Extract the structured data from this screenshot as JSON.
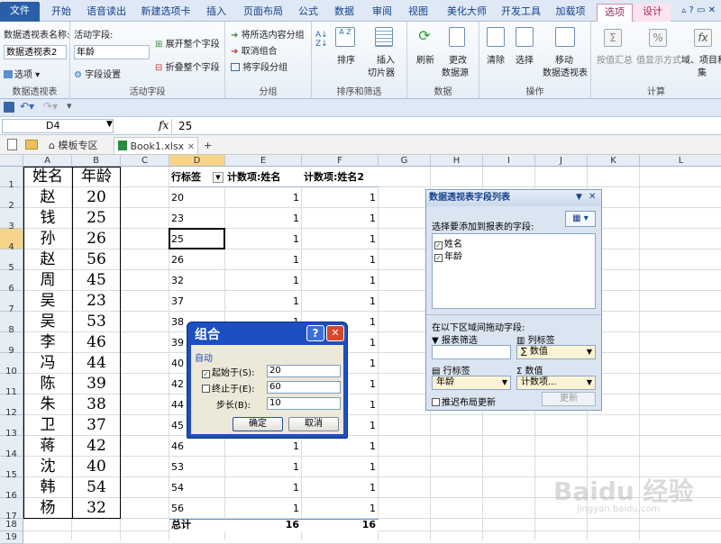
{
  "ribbon_tabs": [
    "文件",
    "开始",
    "语音读出",
    "新建选项卡",
    "插入",
    "页面布局",
    "公式",
    "数据",
    "审阅",
    "视图",
    "美化大师",
    "开发工具",
    "加载项",
    "选项",
    "设计"
  ],
  "ribbon": {
    "pivot_name_label": "数据透视表名称:",
    "pivot_name_value": "数据透视表2",
    "options_btn": "选项",
    "group_pivot": "数据透视表",
    "active_field_label": "活动字段:",
    "active_field_value": "年龄",
    "field_settings": "字段设置",
    "expand_all": "展开整个字段",
    "collapse_all": "折叠整个字段",
    "group_active": "活动字段",
    "group_selection": "将所选内容分组",
    "ungroup": "取消组合",
    "group_field": "将字段分组",
    "group_group": "分组",
    "sort": "排序",
    "insert_slicer_1": "插入",
    "insert_slicer_2": "切片器",
    "group_sort": "排序和筛选",
    "refresh": "刷新",
    "change_src_1": "更改",
    "change_src_2": "数据源",
    "group_data": "数据",
    "clear": "清除",
    "select": "选择",
    "move_1": "移动",
    "move_2": "数据透视表",
    "group_actions": "操作",
    "summarize": "按值汇总",
    "show_values": "值显示方式",
    "fields_items": "域、项目和",
    "fields_items_2": "集",
    "group_calc": "计算"
  },
  "formula_bar": {
    "name_box": "D4",
    "fx": "fx",
    "value": "25"
  },
  "doc_tabs": {
    "template": "模板专区",
    "book": "Book1.xlsx",
    "close": "✕",
    "add": "+"
  },
  "columns": [
    "A",
    "B",
    "C",
    "D",
    "E",
    "F",
    "G",
    "H",
    "I",
    "J",
    "K",
    "L"
  ],
  "rows": [
    "1",
    "2",
    "3",
    "4",
    "5",
    "6",
    "7",
    "8",
    "9",
    "10",
    "11",
    "12",
    "13",
    "14",
    "15",
    "16",
    "17",
    "18",
    "19"
  ],
  "source_table": {
    "headers": [
      "姓名",
      "年龄"
    ],
    "names": [
      "赵",
      "钱",
      "孙",
      "赵",
      "周",
      "吴",
      "吴",
      "李",
      "冯",
      "陈",
      "朱",
      "卫",
      "蒋",
      "沈",
      "韩",
      "杨"
    ],
    "ages": [
      "20",
      "25",
      "26",
      "56",
      "45",
      "23",
      "53",
      "46",
      "44",
      "39",
      "38",
      "37",
      "42",
      "40",
      "54",
      "32"
    ]
  },
  "pivot": {
    "headers": [
      "行标签",
      "计数项:姓名",
      "计数项:姓名2"
    ],
    "labels": [
      "20",
      "23",
      "25",
      "26",
      "32",
      "37",
      "38",
      "39",
      "40",
      "42",
      "44",
      "45",
      "46",
      "53",
      "54",
      "56"
    ],
    "count1": [
      "1",
      "1",
      "1",
      "1",
      "1",
      "1",
      "1",
      "1",
      "1",
      "1",
      "1",
      "1",
      "1",
      "1",
      "1",
      "1"
    ],
    "count2": [
      "1",
      "1",
      "1",
      "1",
      "1",
      "1",
      "1",
      "1",
      "1",
      "1",
      "1",
      "1",
      "1",
      "1",
      "1",
      "1"
    ],
    "total_label": "总计",
    "total1": "16",
    "total2": "16"
  },
  "field_pane": {
    "title": "数据透视表字段列表",
    "choose_label": "选择要添加到报表的字段:",
    "fields": [
      "姓名",
      "年龄"
    ],
    "drag_label": "在以下区域间拖动字段:",
    "report_filter": "报表筛选",
    "column_labels": "列标签",
    "column_value": "∑ 数值",
    "row_labels": "行标签",
    "values_label": "数值",
    "row_value": "年龄",
    "values_value": "计数项...",
    "defer": "推迟布局更新",
    "update": "更新"
  },
  "dialog": {
    "title": "组合",
    "help": "?",
    "close": "✕",
    "section": "自动",
    "start_label": "起始于(S):",
    "start_value": "20",
    "end_label": "终止于(E):",
    "end_value": "60",
    "step_label": "步长(B):",
    "step_value": "10",
    "ok": "确定",
    "cancel": "取消"
  },
  "watermark": "Baidu 经验",
  "watermark_sub": "jingyan.baidu.com"
}
